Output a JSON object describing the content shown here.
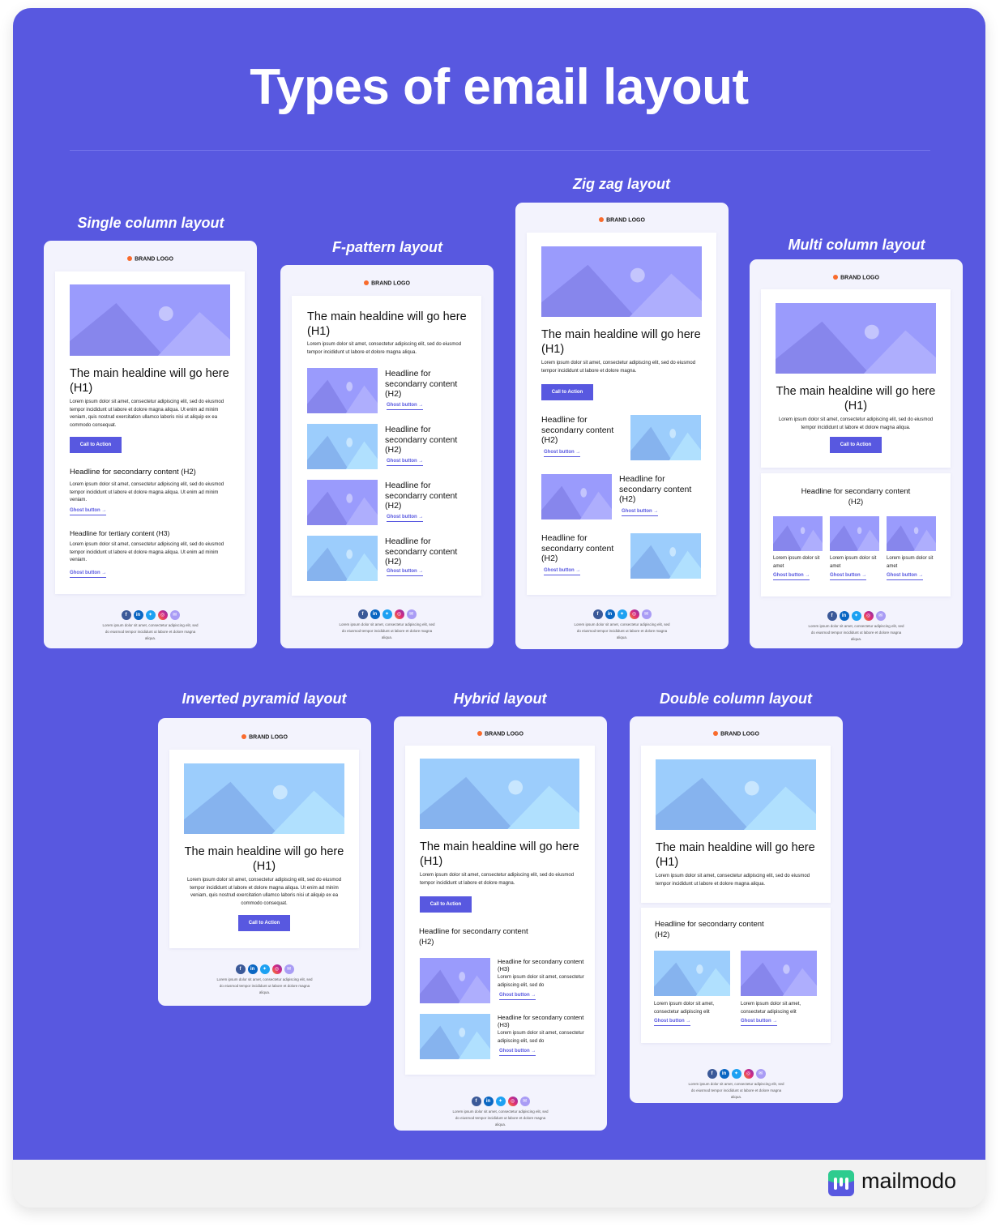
{
  "page": {
    "title": "Types of email layout",
    "brand": "mailmodo"
  },
  "colors": {
    "panel": "#5858e0",
    "accent": "#5858e0",
    "brand_dot": "#f96b2d",
    "img_purple_bg": "#9a9bfc",
    "img_blue_bg": "#9ccdfc"
  },
  "common": {
    "brand_logo": "BRAND LOGO",
    "h1": "The main healdine will go here (H1)",
    "cta": "Call to Action",
    "ghost": "Ghost button →",
    "h2": "Headline for secondarry content (H2)",
    "h3_tertiary": "Headline for tertiary content (H3)",
    "h3_secondary": "Headline for secondarry content (H3)",
    "lorem_long": "Lorem ipsum dolor sit amet, consectetur adipiscing elit, sed do eiusmod tempor incididunt ut labore et dolore magna aliqua. Ut enim ad minim veniam, quis nostrud exercitation ullamco laboris nisi ut aliquip ex ea commodo consequat.",
    "lorem_mid": "Lorem ipsum dolor sit amet, consectetur adipiscing elit, sed do eiusmod tempor incididunt ut labore et dolore magna aliqua. Ut enim ad minim veniam.",
    "lorem_short": "Lorem ipsum dolor sit amet, consectetur adipiscing elit, sed do eiusmod tempor incididunt ut labore et dolore magna aliqua.",
    "lorem_magna": "Lorem ipsum dolor sit amet, consectetur adipiscing elit, sed do eiusmod tempor incididunt ut labore et dolore magna.",
    "lorem_tiny": "Lorem ipsum dolor sit amet",
    "lorem_two": "Lorem ipsum dolor sit amet, consectetur adipiscing elit",
    "lorem_two_do": "Lorem ipsum dolor sit amet, consectetur adipiscing elit, sed do",
    "footer": "Lorem ipsum dolor sit amet, consectetur adipiscing elit, sed do eiusmod tempor incididunt ut labore et dolore magna aliqua.",
    "social_icons": [
      "facebook-icon",
      "linkedin-icon",
      "twitter-icon",
      "instagram-icon",
      "email-icon"
    ]
  },
  "layouts": {
    "single": "Single column layout",
    "fpattern": "F-pattern layout",
    "zigzag": "Zig zag layout",
    "multi": "Multi column layout",
    "pyramid": "Inverted pyramid layout",
    "hybrid": "Hybrid layout",
    "double": "Double column layout"
  }
}
